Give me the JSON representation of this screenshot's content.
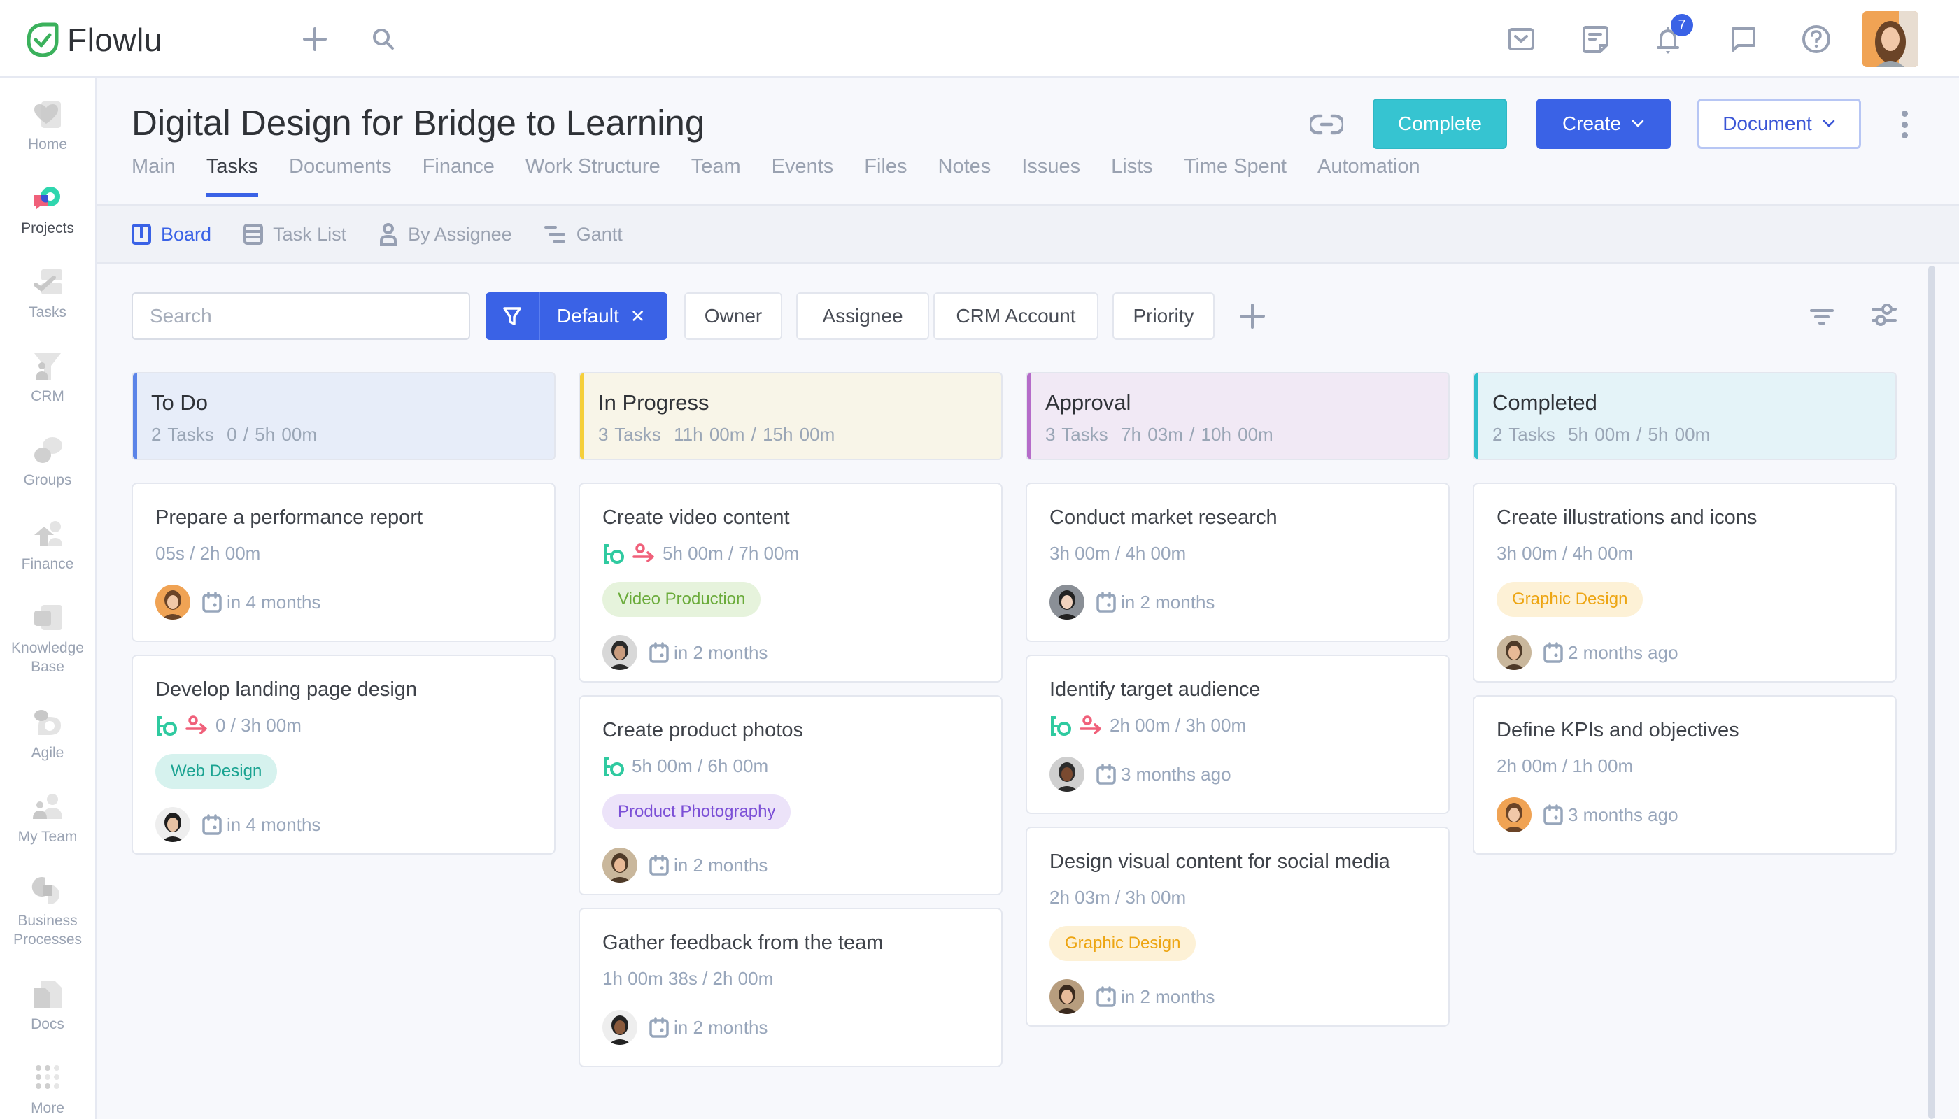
{
  "app": {
    "name": "Flowlu"
  },
  "topbar": {
    "notifications_count": "7",
    "icons": [
      "add-icon",
      "search-icon",
      "mail-icon",
      "notes-icon",
      "bell-icon",
      "chat-icon",
      "help-icon"
    ]
  },
  "sidebar": {
    "items": [
      {
        "label": "Home",
        "icon": "home-icon"
      },
      {
        "label": "Projects",
        "icon": "projects-icon",
        "active": true
      },
      {
        "label": "Tasks",
        "icon": "tasks-icon"
      },
      {
        "label": "CRM",
        "icon": "crm-icon"
      },
      {
        "label": "Groups",
        "icon": "groups-icon"
      },
      {
        "label": "Finance",
        "icon": "finance-icon"
      },
      {
        "label": "Knowledge Base",
        "icon": "knowledge-base-icon"
      },
      {
        "label": "Agile",
        "icon": "agile-icon"
      },
      {
        "label": "My Team",
        "icon": "team-icon"
      },
      {
        "label": "Business Processes",
        "icon": "business-processes-icon"
      },
      {
        "label": "Docs",
        "icon": "docs-icon"
      },
      {
        "label": "More",
        "icon": "more-grid-icon"
      }
    ]
  },
  "header": {
    "title": "Digital Design for Bridge to Learning",
    "complete_label": "Complete",
    "create_label": "Create",
    "document_label": "Document"
  },
  "tabs": [
    {
      "label": "Main"
    },
    {
      "label": "Tasks",
      "active": true
    },
    {
      "label": "Documents"
    },
    {
      "label": "Finance"
    },
    {
      "label": "Work Structure"
    },
    {
      "label": "Team"
    },
    {
      "label": "Events"
    },
    {
      "label": "Files"
    },
    {
      "label": "Notes"
    },
    {
      "label": "Issues"
    },
    {
      "label": "Lists"
    },
    {
      "label": "Time Spent"
    },
    {
      "label": "Automation"
    }
  ],
  "views": [
    {
      "label": "Board",
      "active": true
    },
    {
      "label": "Task List"
    },
    {
      "label": "By Assignee"
    },
    {
      "label": "Gantt"
    }
  ],
  "filters": {
    "search_placeholder": "Search",
    "default_label": "Default",
    "chips": [
      "Owner",
      "Assignee",
      "CRM Account",
      "Priority"
    ]
  },
  "colors": {
    "accent": "#3a62e6",
    "complete": "#36c4d1",
    "todo": "#5b84e8",
    "in_progress": "#f5cf3a",
    "approval": "#b56cc9",
    "completed": "#2fbfcc"
  },
  "columns": [
    {
      "name": "To Do",
      "tasks_count": "2 Tasks",
      "time": "0 / 5h 00m",
      "cards": [
        {
          "title": "Prepare a performance report",
          "time": "05s / 2h 00m",
          "due": "in 4 months",
          "icons": []
        },
        {
          "title": "Develop landing page design",
          "time": "0 / 3h 00m",
          "tag": "Web Design",
          "due": "in 4 months",
          "icons": [
            "subtasks-icon",
            "delegated-icon"
          ]
        }
      ]
    },
    {
      "name": "In Progress",
      "tasks_count": "3 Tasks",
      "time": "11h 00m / 15h 00m",
      "cards": [
        {
          "title": "Create video content",
          "time": "5h 00m / 7h 00m",
          "tag": "Video Production",
          "due": "in 2 months",
          "icons": [
            "subtasks-icon",
            "delegated-icon"
          ]
        },
        {
          "title": "Create product photos",
          "time": "5h 00m / 6h 00m",
          "tag": "Product Photography",
          "due": "in 2 months",
          "icons": [
            "subtasks-icon"
          ]
        },
        {
          "title": "Gather feedback from the team",
          "time": "1h 00m 38s / 2h 00m",
          "due": "in 2 months",
          "icons": []
        }
      ]
    },
    {
      "name": "Approval",
      "tasks_count": "3 Tasks",
      "time": "7h 03m / 10h 00m",
      "cards": [
        {
          "title": "Conduct market research",
          "time": "3h 00m / 4h 00m",
          "due": "in 2 months",
          "icons": []
        },
        {
          "title": "Identify target audience",
          "time": "2h 00m / 3h 00m",
          "due": "3 months ago",
          "icons": [
            "subtasks-icon",
            "delegated-icon"
          ]
        },
        {
          "title": "Design visual content for social media",
          "time": "2h 03m / 3h 00m",
          "tag": "Graphic Design",
          "due": "in 2 months",
          "icons": []
        }
      ]
    },
    {
      "name": "Completed",
      "tasks_count": "2 Tasks",
      "time": "5h 00m / 5h 00m",
      "cards": [
        {
          "title": "Create illustrations and icons",
          "time": "3h 00m / 4h 00m",
          "tag": "Graphic Design",
          "due": "2 months ago",
          "icons": []
        },
        {
          "title": "Define KPIs and objectives",
          "time": "2h 00m / 1h 00m",
          "due": "3 months ago",
          "icons": []
        }
      ]
    }
  ]
}
